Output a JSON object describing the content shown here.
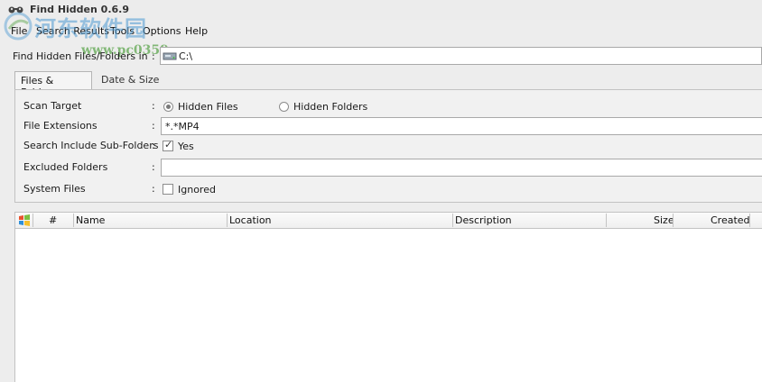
{
  "window": {
    "title": "Find Hidden 0.6.9"
  },
  "watermark": {
    "line1": "河东软件园",
    "line2": "www.pc0359.cn"
  },
  "menu": [
    "File",
    "Search Results",
    "Tools",
    "Options",
    "Help"
  ],
  "path": {
    "label": "Find Hidden Files/Folders in",
    "value": "C:\\"
  },
  "tabs": [
    "Files & Folders",
    "Date & Size"
  ],
  "form": {
    "scan_target": {
      "label": "Scan Target",
      "options": [
        "Hidden Files",
        "Hidden Folders"
      ],
      "selected": "Hidden Files"
    },
    "file_extensions": {
      "label": "File Extensions",
      "value": "*.*MP4"
    },
    "sub_folders": {
      "label": "Search Include Sub-Folders",
      "checked": true,
      "text": "Yes"
    },
    "excluded_folders": {
      "label": "Excluded Folders",
      "value": ""
    },
    "system_files": {
      "label": "System Files",
      "checked": false,
      "text": "Ignored"
    }
  },
  "colon": ":",
  "results": {
    "columns": [
      "#",
      "Name",
      "Location",
      "Description",
      "Size",
      "Created"
    ]
  }
}
